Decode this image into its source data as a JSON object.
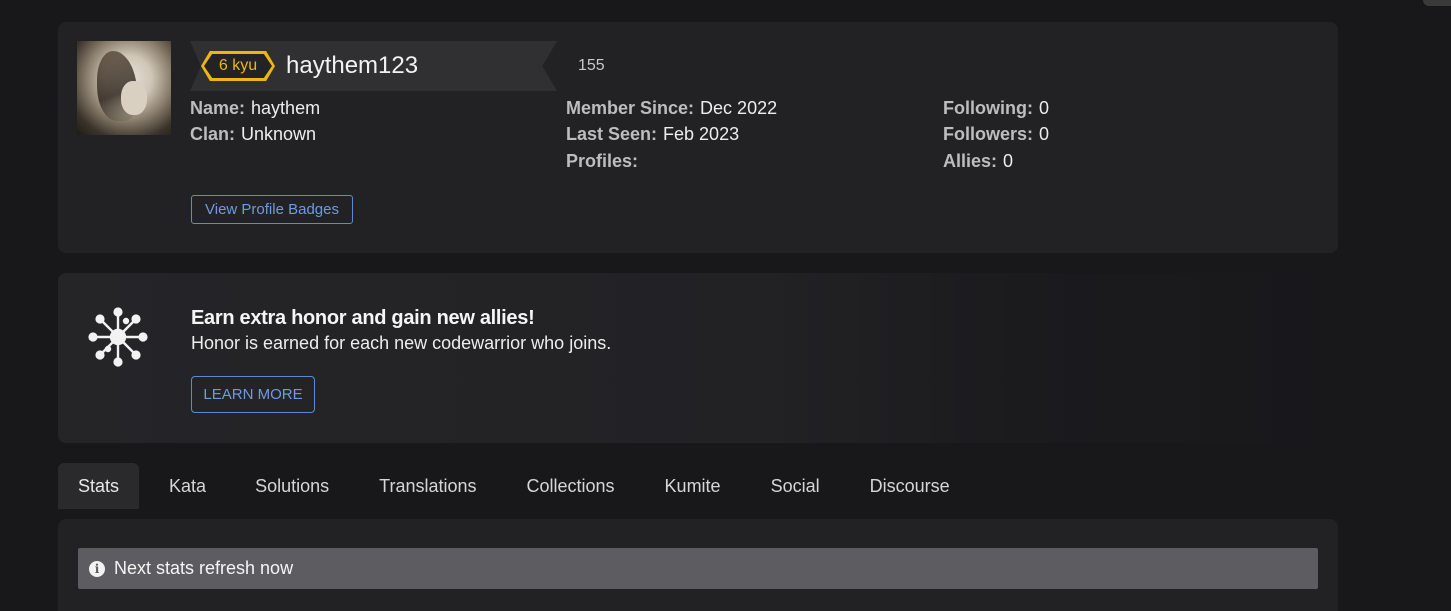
{
  "profile": {
    "rank": "6 kyu",
    "username": "haythem123",
    "honor": "155",
    "fields_left": [
      {
        "label": "Name:",
        "value": "haythem"
      },
      {
        "label": "Clan:",
        "value": "Unknown"
      }
    ],
    "fields_middle": [
      {
        "label": "Member Since:",
        "value": "Dec 2022"
      },
      {
        "label": "Last Seen:",
        "value": "Feb 2023"
      },
      {
        "label": "Profiles:",
        "value": ""
      }
    ],
    "fields_right": [
      {
        "label": "Following:",
        "value": "0"
      },
      {
        "label": "Followers:",
        "value": "0"
      },
      {
        "label": "Allies:",
        "value": "0"
      }
    ],
    "badges_button": "View Profile Badges"
  },
  "promo": {
    "icon": "network-star-icon",
    "title": "Earn extra honor and gain new allies!",
    "text": "Honor is earned for each new codewarrior who joins.",
    "button": "LEARN MORE"
  },
  "tabs": [
    {
      "label": "Stats",
      "active": true
    },
    {
      "label": "Kata"
    },
    {
      "label": "Solutions"
    },
    {
      "label": "Translations"
    },
    {
      "label": "Collections"
    },
    {
      "label": "Kumite"
    },
    {
      "label": "Social"
    },
    {
      "label": "Discourse"
    }
  ],
  "stats": {
    "info_icon": "i",
    "refresh_text": "Next stats refresh now"
  },
  "colors": {
    "background": "#18181b",
    "card": "#222225",
    "rank_yellow": "#ecb613",
    "link_blue": "#6f9ae0"
  }
}
